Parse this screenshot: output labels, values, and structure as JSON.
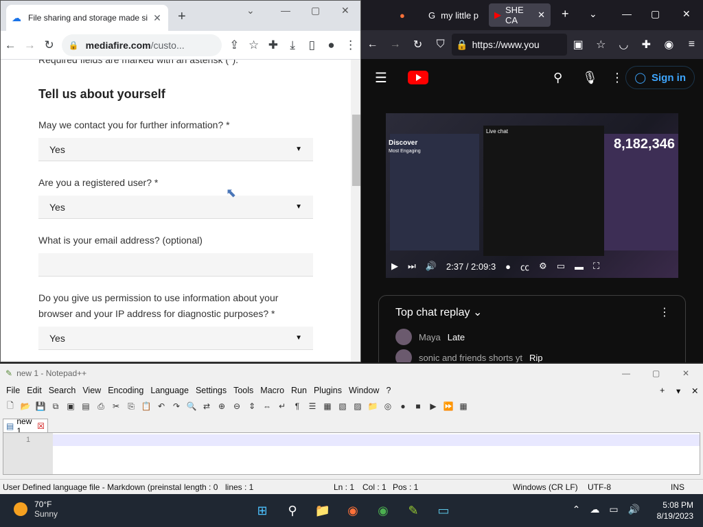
{
  "chrome": {
    "tab_title": "File sharing and storage made si",
    "domain": "mediafire.com",
    "path": "/custo...",
    "new_tab": "+",
    "page": {
      "cut_text": "Required fields are marked with an asterisk (*).",
      "heading": "Tell us about yourself",
      "q1": "May we contact you for further information? *",
      "q1_value": "Yes",
      "q2": "Are you a registered user? *",
      "q2_value": "Yes",
      "q3": "What is your email address? (optional)",
      "q4": "Do you give us permission to use information about your browser and your IP address for diagnostic purposes? *",
      "q4_value": "Yes"
    }
  },
  "firefox": {
    "tab1": "my little p",
    "tab2": "SHE CA",
    "url": "https://www.you",
    "signin": "Sign in",
    "video": {
      "stat": "8,182,346",
      "discover": "Discover",
      "time": "2:37 / 2:09:3",
      "most_engaging": "Most Engaging",
      "live_chat": "Live chat"
    },
    "chat": {
      "title": "Top chat replay",
      "rows": [
        {
          "name": "Maya",
          "msg": "Late"
        },
        {
          "name": "sonic and friends shorts yt",
          "msg": "Rip"
        }
      ]
    }
  },
  "npp": {
    "title": "new 1 - Notepad++",
    "menu": [
      "File",
      "Edit",
      "Search",
      "View",
      "Encoding",
      "Language",
      "Settings",
      "Tools",
      "Macro",
      "Run",
      "Plugins",
      "Window",
      "?"
    ],
    "tab": "new 1",
    "line_no": "1",
    "status": {
      "lang": "User Defined language file - Markdown (preinstal",
      "length": "length : 0",
      "lines": "lines : 1",
      "ln": "Ln : 1",
      "col": "Col : 1",
      "pos": "Pos : 1",
      "eol": "Windows (CR LF)",
      "enc": "UTF-8",
      "mode": "INS"
    }
  },
  "taskbar": {
    "temp": "70°F",
    "cond": "Sunny",
    "time": "5:08 PM",
    "date": "8/19/2023"
  }
}
